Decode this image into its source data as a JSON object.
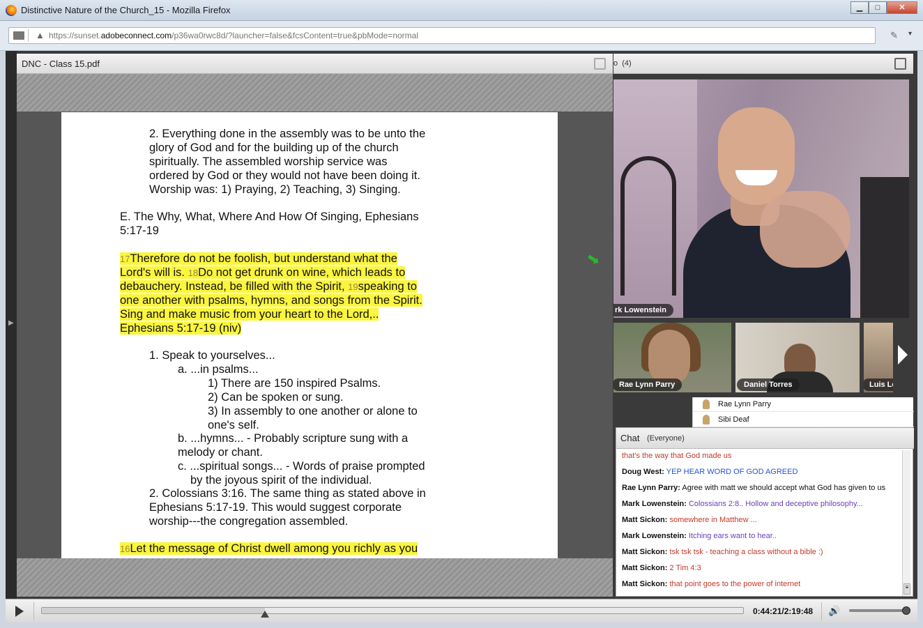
{
  "window": {
    "title": "Distinctive Nature of the Church_15 - Mozilla Firefox",
    "minimize": "▁",
    "maximize": "□",
    "close": "✕"
  },
  "browser": {
    "url_prefix": "https://sunset.",
    "url_domain": "adobeconnect.com",
    "url_path": "/p36wa0rwc8d/?launcher=false&fcsContent=true&pbMode=normal",
    "warning_icon": "warning-icon",
    "menu_label": "▾"
  },
  "pdf_pod": {
    "title": "DNC - Class 15.pdf",
    "lines": [
      {
        "text": "2. Everything done in the assembly was to be unto the"
      },
      {
        "text": "glory of God and for the building up of the church"
      },
      {
        "text": "spiritually. The assembled worship service was"
      },
      {
        "text": "ordered by God or they would not have been doing it."
      },
      {
        "text": "Worship was: 1) Praying, 2) Teaching, 3) Singing."
      },
      {
        "text": "E. The Why, What, Where And How Of Singing, Ephesians"
      },
      {
        "text": "5:17-19"
      },
      {
        "vnum": "17",
        "text": "Therefore do not be foolish, but understand what the"
      },
      {
        "text": "Lord's will is. ",
        "vnum2": "18",
        "text2": "Do not get drunk on wine, which leads to"
      },
      {
        "text": "debauchery. Instead, be filled with the Spirit, ",
        "vnum2": "19",
        "text2": "speaking to"
      },
      {
        "text": "one another with psalms, hymns, and songs from the Spirit."
      },
      {
        "text": "Sing and make music from your heart to the Lord,.."
      },
      {
        "text": "Ephesians 5:17-19 (niv)"
      },
      {
        "text": "1. Speak to yourselves..."
      },
      {
        "text": "a. ...in psalms..."
      },
      {
        "text": "1) There are 150 inspired Psalms."
      },
      {
        "text": "2) Can be spoken or sung."
      },
      {
        "text": "3) In assembly to one another or alone to"
      },
      {
        "text": "one's self."
      },
      {
        "text": "b. ...hymns... - Probably scripture sung with a"
      },
      {
        "text": "melody or chant."
      },
      {
        "text": "c. ...spiritual songs... - Words of praise prompted"
      },
      {
        "text": "by the joyous spirit of the individual."
      },
      {
        "text": "2. Colossians 3:16. The same thing as stated above in"
      },
      {
        "text": "Ephesians 5:17-19. This would suggest corporate"
      },
      {
        "text": "worship---the congregation assembled."
      },
      {
        "vnum": "16",
        "text": "Let the message of Christ dwell among you richly as you"
      }
    ]
  },
  "camera_pod": {
    "title_fragment": "o",
    "count": "(4)",
    "main_speaker": "rk Lowenstein",
    "thumbnails": [
      {
        "name": "Rae Lynn Parry"
      },
      {
        "name": "Daniel Torres"
      },
      {
        "name": "Luis Le"
      }
    ]
  },
  "attendees": [
    {
      "name": "Rae Lynn Parry"
    },
    {
      "name": "Sibi Deaf"
    }
  ],
  "chat": {
    "title": "Chat",
    "scope": "(Everyone)",
    "messages": [
      {
        "sender": "",
        "text": "that's the way that God made us",
        "color": "#c0392b"
      },
      {
        "sender": "Doug West:",
        "text": "YEP HEAR WORD OF GOD   AGREED",
        "color": "#2255cc"
      },
      {
        "sender": "Rae Lynn Parry:",
        "text": "Agree with matt we should accept what God has given to us",
        "color": "#111111"
      },
      {
        "sender": "Mark Lowenstein:",
        "text": "Colossians 2:8.. Hollow and deceptive philosophy...",
        "color": "#6a3fb5"
      },
      {
        "sender": "Matt Sickon:",
        "text": "somewhere in Matthew ...",
        "color": "#c0392b"
      },
      {
        "sender": "Mark Lowenstein:",
        "text": "Itching ears want to hear..",
        "color": "#6a3fb5"
      },
      {
        "sender": "Matt Sickon:",
        "text": "tsk tsk tsk - teaching a class without a bible :)",
        "color": "#c0392b"
      },
      {
        "sender": "Matt Sickon:",
        "text": "2 Tim 4:3",
        "color": "#c0392b"
      },
      {
        "sender": "Matt Sickon:",
        "text": "that point goes to the power of internet",
        "color": "#c0392b"
      }
    ]
  },
  "player": {
    "time": "0:44:21/2:19:48",
    "progress": 0.3185,
    "volume": 0.95
  }
}
